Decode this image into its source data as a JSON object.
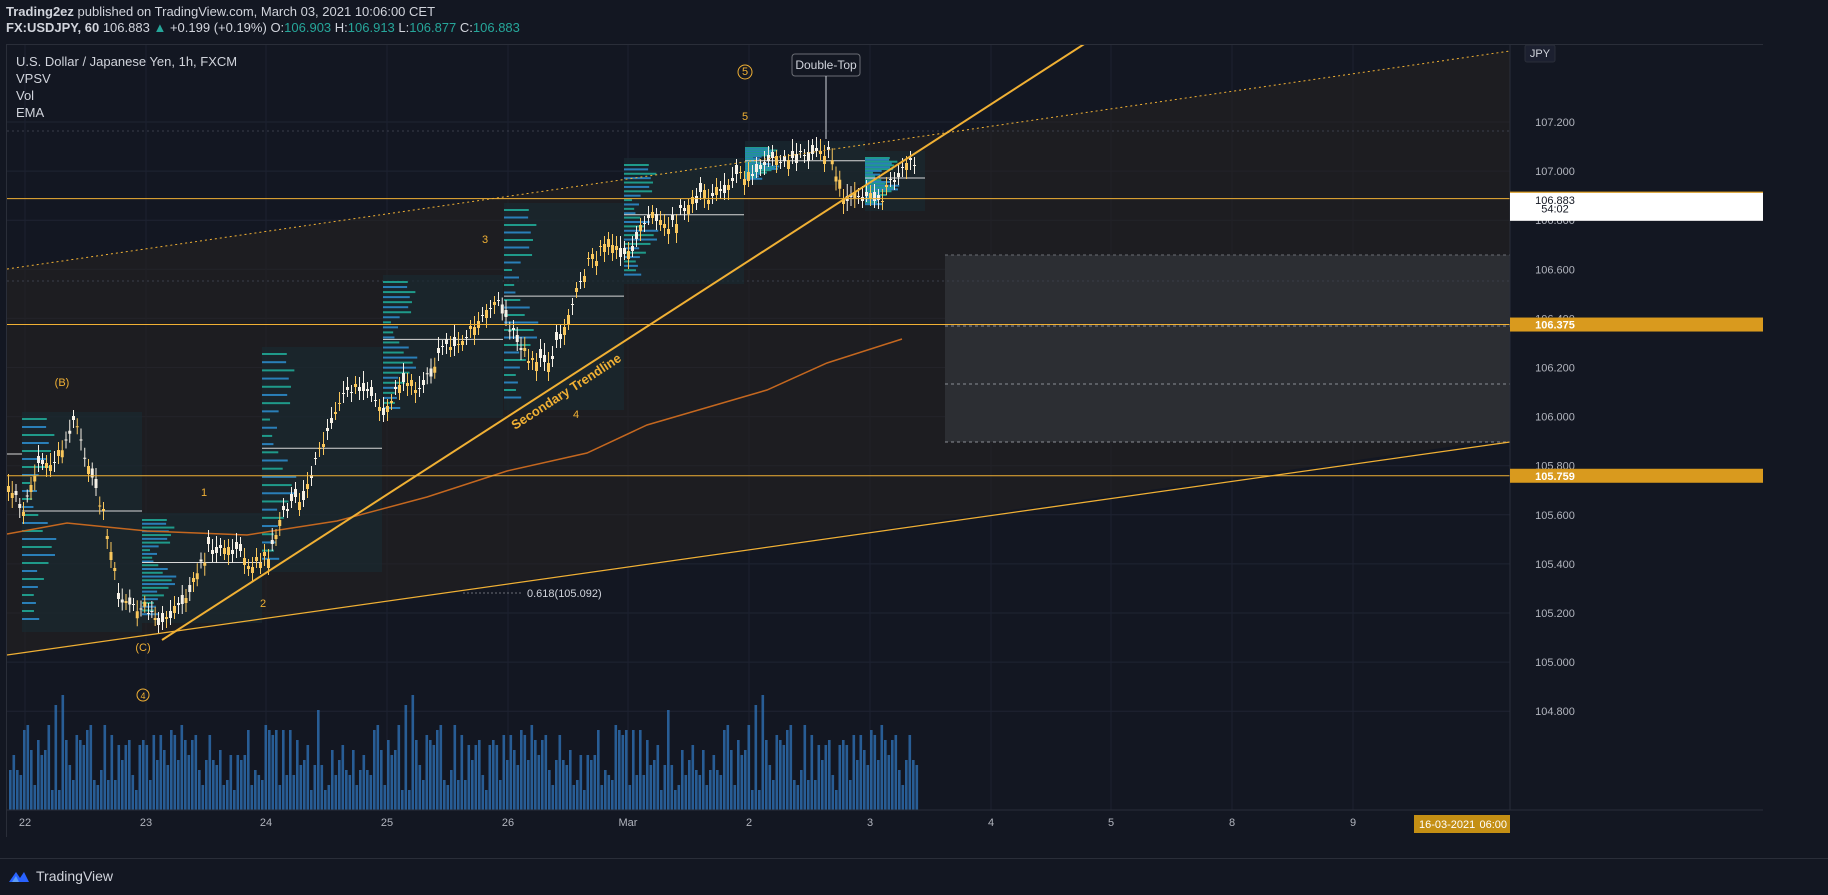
{
  "header": {
    "publisher": "Trading2ez",
    "published_text": "published on TradingView.com, March 03, 2021 10:06:00 CET",
    "symbol": "FX:USDJPY, 60",
    "last": "106.883",
    "arrow": "▲",
    "change": "+0.199 (+0.19%)",
    "o_label": "O:",
    "o_value": "106.903",
    "h_label": "H:",
    "h_value": "106.913",
    "l_label": "L:",
    "l_value": "106.877",
    "c_label": "C:",
    "c_value": "106.883"
  },
  "legend": {
    "title": "U.S. Dollar / Japanese Yen, 1h, FXCM",
    "indicators": [
      "VPSV",
      "Vol",
      "EMA"
    ]
  },
  "currency_button": "JPY",
  "price_axis": {
    "ticks": [
      "107.200",
      "107.000",
      "106.800",
      "106.600",
      "106.400",
      "106.200",
      "106.000",
      "105.800",
      "105.600",
      "105.400",
      "105.200",
      "105.000",
      "104.800"
    ],
    "labels": [
      {
        "text": "106.888",
        "price": 106.888,
        "kind": "level"
      },
      {
        "text": "106.883",
        "price": 106.883,
        "kind": "last"
      },
      {
        "text": "54:02",
        "price": 106.848,
        "kind": "countdown"
      },
      {
        "text": "106.375",
        "price": 106.375,
        "kind": "level"
      },
      {
        "text": "105.759",
        "price": 105.759,
        "kind": "level"
      }
    ]
  },
  "time_axis": {
    "ticks": [
      "22",
      "23",
      "24",
      "25",
      "26",
      "Mar",
      "2",
      "3",
      "4",
      "5",
      "8",
      "9"
    ],
    "cursor_label": "16-03-2021",
    "cursor_time": "06:00"
  },
  "annotations": {
    "double_top": "Double-Top",
    "trendline_label": "Secondary Trendline",
    "fib_label": "0.618(105.092)",
    "waves": [
      "(B)",
      "(C)",
      "1",
      "2",
      "3",
      "4",
      "5",
      "5",
      "4"
    ]
  },
  "footer": {
    "brand": "TradingView"
  },
  "colors": {
    "background": "#131722",
    "accent": "#f0b034",
    "bull": "#f9c75c",
    "volume": "#2e6fb3",
    "ema": "#c4671f"
  },
  "chart_data": {
    "type": "candlestick",
    "title": "U.S. Dollar / Japanese Yen, 1h, FXCM",
    "y_range": [
      104.62,
      107.35
    ],
    "price_levels": [
      106.888,
      106.375,
      105.759
    ],
    "series": [
      {
        "name": "USDJPY close (approx.)",
        "points": [
          [
            "22",
            105.55
          ],
          [
            "22",
            105.72
          ],
          [
            "22",
            105.8
          ],
          [
            "23",
            105.05
          ],
          [
            "23",
            104.98
          ],
          [
            "23",
            105.3
          ],
          [
            "24",
            105.3
          ],
          [
            "24",
            105.55
          ],
          [
            "24",
            105.95
          ],
          [
            "25",
            105.85
          ],
          [
            "25",
            106.05
          ],
          [
            "25",
            106.15
          ],
          [
            "26",
            106.25
          ],
          [
            "26",
            106.0
          ],
          [
            "26",
            106.4
          ],
          [
            "Mar",
            106.55
          ],
          [
            "Mar",
            106.7
          ],
          [
            "2",
            106.8
          ],
          [
            "2",
            106.92
          ],
          [
            "3",
            106.75
          ],
          [
            "3",
            106.85
          ],
          [
            "3",
            106.883
          ]
        ]
      },
      {
        "name": "EMA",
        "points": [
          [
            "22",
            105.37
          ],
          [
            "23",
            105.38
          ],
          [
            "24",
            105.35
          ],
          [
            "25",
            105.45
          ],
          [
            "26",
            105.65
          ],
          [
            "Mar",
            105.8
          ],
          [
            "2",
            106.0
          ],
          [
            "3",
            106.15
          ]
        ]
      }
    ]
  }
}
